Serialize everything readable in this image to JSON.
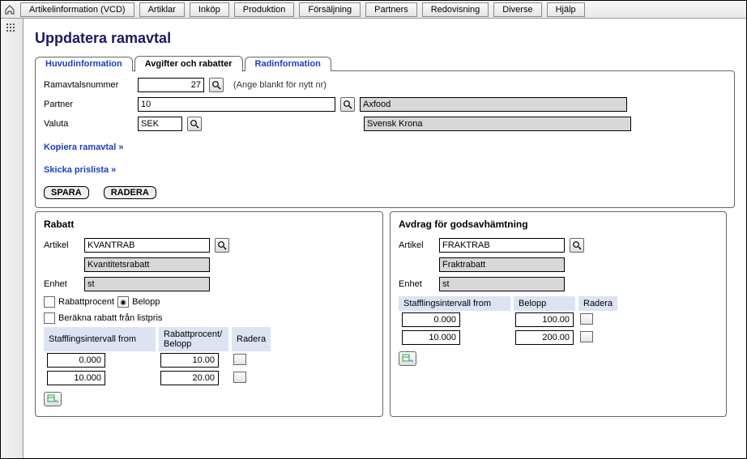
{
  "menu": [
    "Artikelinformation (VCD)",
    "Artiklar",
    "Inköp",
    "Produktion",
    "Försäljning",
    "Partners",
    "Redovisning",
    "Diverse",
    "Hjälp"
  ],
  "page_title": "Uppdatera ramavtal",
  "tabs": {
    "t0": "Huvudinformation",
    "t1": "Avgifter och rabatter",
    "t2": "Radinformation"
  },
  "form": {
    "ramavtal_label": "Ramavtalsnummer",
    "ramavtal_value": "27",
    "ramavtal_hint": "(Ange blankt för nytt nr)",
    "partner_label": "Partner",
    "partner_value": "10",
    "partner_name": "Axfood",
    "valuta_label": "Valuta",
    "valuta_value": "SEK",
    "valuta_name": "Svensk Krona"
  },
  "links": {
    "kopiera": "Kopiera ramavtal »",
    "skicka": "Skicka prislista »"
  },
  "buttons": {
    "spara": "SPARA",
    "radera": "RADERA"
  },
  "rabatt": {
    "title": "Rabatt",
    "artikel_label": "Artikel",
    "artikel_value": "KVANTRAB",
    "artikel_desc": "Kvantitetsrabatt",
    "enhet_label": "Enhet",
    "enhet_value": "st",
    "radio_rp": "Rabattprocent",
    "radio_bl": "Belopp",
    "check_calc": "Beräkna rabatt från listpris",
    "col_from": "Stafflingsintervall from",
    "col_val": "Rabattprocent/\nBelopp",
    "col_del": "Radera",
    "rows": [
      {
        "from": "0.000",
        "val": "10.00"
      },
      {
        "from": "10.000",
        "val": "20.00"
      }
    ]
  },
  "avdrag": {
    "title": "Avdrag för godsavhämtning",
    "artikel_label": "Artikel",
    "artikel_value": "FRAKTRAB",
    "artikel_desc": "Fraktrabatt",
    "enhet_label": "Enhet",
    "enhet_value": "st",
    "col_from": "Stafflingsintervall from",
    "col_val": "Belopp",
    "col_del": "Radera",
    "rows": [
      {
        "from": "0.000",
        "val": "100.00"
      },
      {
        "from": "10.000",
        "val": "200.00"
      }
    ]
  }
}
